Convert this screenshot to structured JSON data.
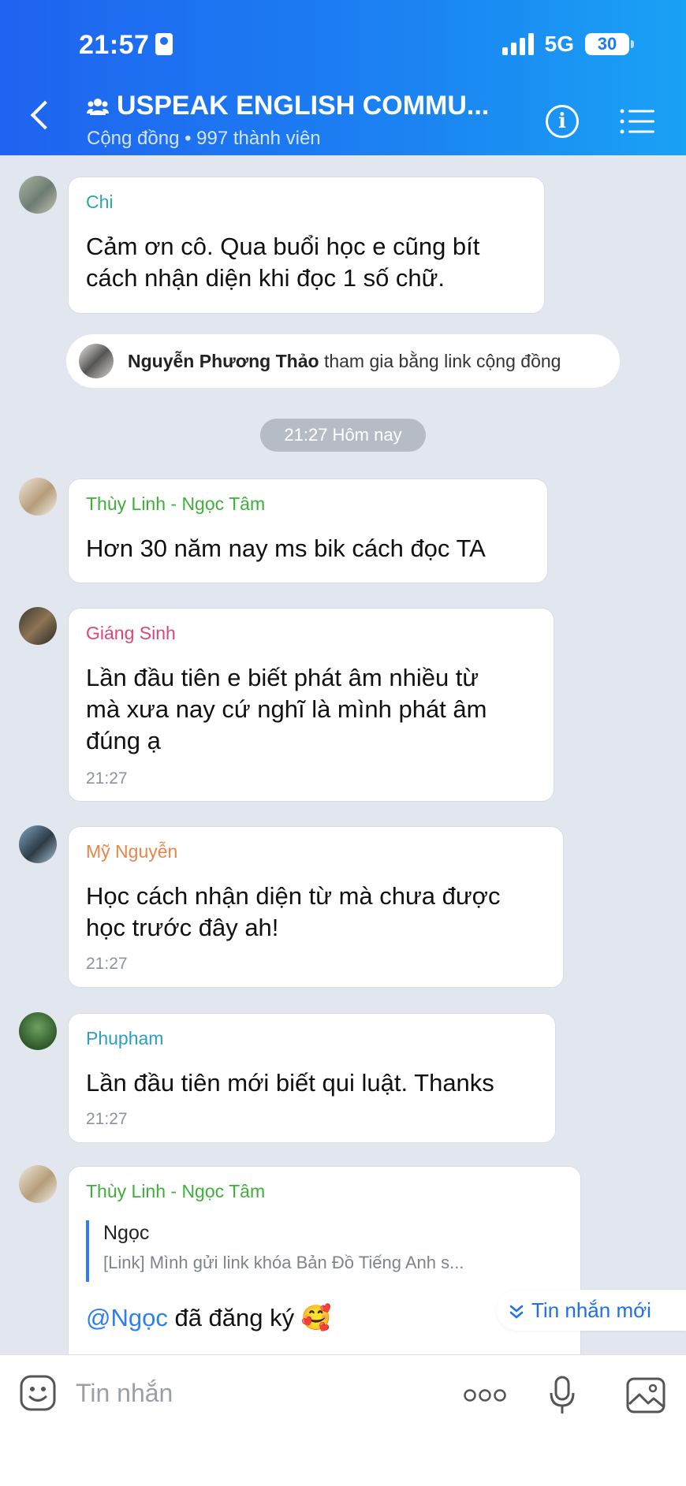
{
  "status": {
    "time": "21:57",
    "network": "5G",
    "battery": "30"
  },
  "header": {
    "title": "USPEAK ENGLISH COMMU...",
    "subtitle": "Cộng đồng • 997 thành viên",
    "info_icon": "info-icon",
    "menu_icon": "list-menu-icon"
  },
  "messages": [
    {
      "sender": "Chi",
      "sender_color": "#2ba7a6",
      "text": [
        "Cảm ơn cô. Qua buổi học e cũng bít",
        "cách nhận diện khi đọc 1 số chữ."
      ]
    },
    {
      "sender": "Thùy Linh - Ngọc Tâm",
      "sender_color": "#3fae3a",
      "text": [
        "Hơn 30 năm nay ms bik cách đọc TA"
      ]
    },
    {
      "sender": "Giáng Sinh",
      "sender_color": "#d9487a",
      "text": [
        "Lần đầu tiên  e biết phát âm nhiều từ",
        "mà xưa nay cứ nghĩ là mình phát âm",
        "đúng ạ"
      ],
      "time": "21:27"
    },
    {
      "sender": "Mỹ Nguyễn",
      "sender_color": "#e7864a",
      "text": [
        "Học cách nhận diện từ mà chưa được",
        "học trước đây ah!"
      ],
      "time": "21:27"
    },
    {
      "sender": "Phupham",
      "sender_color": "#2c9ec8",
      "text": [
        "Lần đầu tiên mới biết qui luật. Thanks"
      ],
      "time": "21:27"
    },
    {
      "sender": "Thùy Linh - Ngọc Tâm",
      "sender_color": "#3fae3a",
      "quote": {
        "name": "Ngọc",
        "text": "[Link] Mình gửi link khóa Bản Đồ Tiếng Anh s..."
      },
      "mention": "@Ngọc",
      "text_after": " đã đăng ký 🥰"
    }
  ],
  "join_notice": {
    "name": "Nguyễn Phương Thảo",
    "text": " tham gia bằng link cộng đồng"
  },
  "date_divider": "21:27 Hôm nay",
  "new_messages_label": "Tin nhắn mới",
  "composer": {
    "placeholder": "Tin nhắn"
  },
  "colors": {
    "accent": "#1e6ff0",
    "header_gradient_start": "#1f63f0",
    "header_gradient_end": "#1aa2f5",
    "background": "#e2e7ef"
  }
}
